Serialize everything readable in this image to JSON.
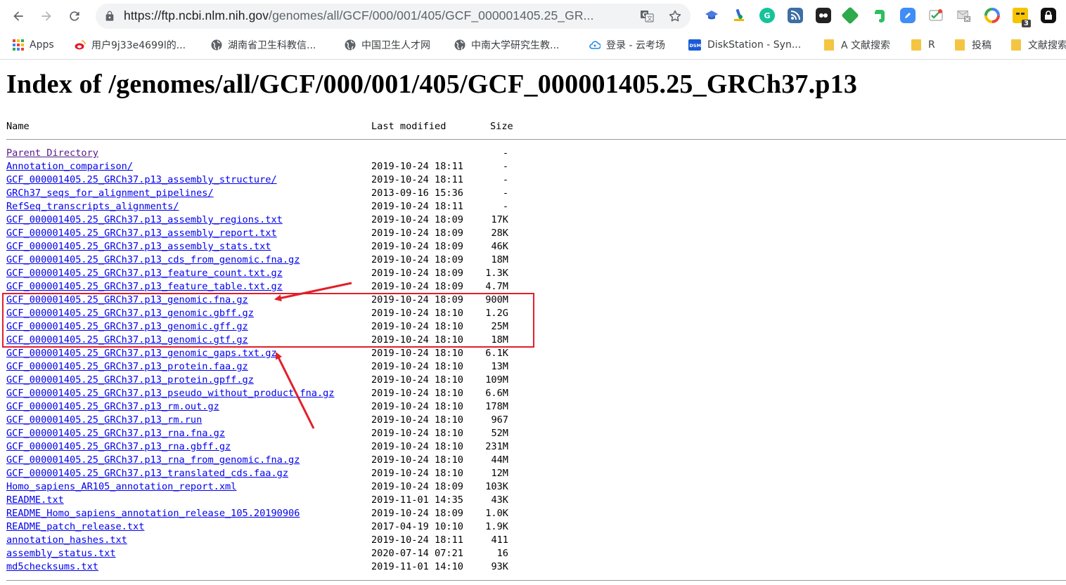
{
  "browser": {
    "url_host": "https://ftp.ncbi.nlm.nih.gov",
    "url_path": "/genomes/all/GCF/000/001/405/GCF_000001405.25_GR...",
    "extension_badge": "3"
  },
  "bookmarks": [
    {
      "label": "Apps",
      "icon": "apps-grid-icon"
    },
    {
      "label": "用户9j33e4699l的...",
      "icon": "weibo-icon"
    },
    {
      "label": "湖南省卫生科教信...",
      "icon": "globe-icon"
    },
    {
      "label": "中国卫生人才网",
      "icon": "globe-icon"
    },
    {
      "label": "中南大学研究生教...",
      "icon": "globe-icon"
    },
    {
      "label": "登录 - 云考场",
      "icon": "cloud-icon"
    },
    {
      "label": "DiskStation - Syn...",
      "icon": "dsm-icon"
    },
    {
      "label": "A 文献搜索",
      "icon": "folder-icon"
    },
    {
      "label": "R",
      "icon": "folder-icon"
    },
    {
      "label": "投稿",
      "icon": "folder-icon"
    },
    {
      "label": "文献搜索",
      "icon": "folder-icon"
    }
  ],
  "page": {
    "title": "Index of /genomes/all/GCF/000/001/405/GCF_000001405.25_GRCh37.p13",
    "columns": {
      "name": "Name",
      "modified": "Last modified",
      "size": "Size"
    },
    "rows": [
      {
        "name": "Parent Directory",
        "date": "",
        "size": "-"
      },
      {
        "name": "Annotation_comparison/",
        "date": "2019-10-24 18:11",
        "size": "-"
      },
      {
        "name": "GCF_000001405.25_GRCh37.p13_assembly_structure/",
        "date": "2019-10-24 18:11",
        "size": "-"
      },
      {
        "name": "GRCh37_seqs_for_alignment_pipelines/",
        "date": "2013-09-16 15:36",
        "size": "-"
      },
      {
        "name": "RefSeq_transcripts_alignments/",
        "date": "2019-10-24 18:11",
        "size": "-"
      },
      {
        "name": "GCF_000001405.25_GRCh37.p13_assembly_regions.txt",
        "date": "2019-10-24 18:09",
        "size": "17K"
      },
      {
        "name": "GCF_000001405.25_GRCh37.p13_assembly_report.txt",
        "date": "2019-10-24 18:09",
        "size": "28K"
      },
      {
        "name": "GCF_000001405.25_GRCh37.p13_assembly_stats.txt",
        "date": "2019-10-24 18:09",
        "size": "46K"
      },
      {
        "name": "GCF_000001405.25_GRCh37.p13_cds_from_genomic.fna.gz",
        "date": "2019-10-24 18:09",
        "size": "18M"
      },
      {
        "name": "GCF_000001405.25_GRCh37.p13_feature_count.txt.gz",
        "date": "2019-10-24 18:09",
        "size": "1.3K"
      },
      {
        "name": "GCF_000001405.25_GRCh37.p13_feature_table.txt.gz",
        "date": "2019-10-24 18:09",
        "size": "4.7M"
      },
      {
        "name": "GCF_000001405.25_GRCh37.p13_genomic.fna.gz",
        "date": "2019-10-24 18:09",
        "size": "900M"
      },
      {
        "name": "GCF_000001405.25_GRCh37.p13_genomic.gbff.gz",
        "date": "2019-10-24 18:10",
        "size": "1.2G"
      },
      {
        "name": "GCF_000001405.25_GRCh37.p13_genomic.gff.gz",
        "date": "2019-10-24 18:10",
        "size": "25M"
      },
      {
        "name": "GCF_000001405.25_GRCh37.p13_genomic.gtf.gz",
        "date": "2019-10-24 18:10",
        "size": "18M"
      },
      {
        "name": "GCF_000001405.25_GRCh37.p13_genomic_gaps.txt.gz",
        "date": "2019-10-24 18:10",
        "size": "6.1K"
      },
      {
        "name": "GCF_000001405.25_GRCh37.p13_protein.faa.gz",
        "date": "2019-10-24 18:10",
        "size": "13M"
      },
      {
        "name": "GCF_000001405.25_GRCh37.p13_protein.gpff.gz",
        "date": "2019-10-24 18:10",
        "size": "109M"
      },
      {
        "name": "GCF_000001405.25_GRCh37.p13_pseudo_without_product.fna.gz",
        "date": "2019-10-24 18:10",
        "size": "6.6M"
      },
      {
        "name": "GCF_000001405.25_GRCh37.p13_rm.out.gz",
        "date": "2019-10-24 18:10",
        "size": "178M"
      },
      {
        "name": "GCF_000001405.25_GRCh37.p13_rm.run",
        "date": "2019-10-24 18:10",
        "size": "967"
      },
      {
        "name": "GCF_000001405.25_GRCh37.p13_rna.fna.gz",
        "date": "2019-10-24 18:10",
        "size": "52M"
      },
      {
        "name": "GCF_000001405.25_GRCh37.p13_rna.gbff.gz",
        "date": "2019-10-24 18:10",
        "size": "231M"
      },
      {
        "name": "GCF_000001405.25_GRCh37.p13_rna_from_genomic.fna.gz",
        "date": "2019-10-24 18:10",
        "size": "44M"
      },
      {
        "name": "GCF_000001405.25_GRCh37.p13_translated_cds.faa.gz",
        "date": "2019-10-24 18:10",
        "size": "12M"
      },
      {
        "name": "Homo_sapiens_AR105_annotation_report.xml",
        "date": "2019-10-24 18:09",
        "size": "103K"
      },
      {
        "name": "README.txt",
        "date": "2019-11-01 14:35",
        "size": "43K"
      },
      {
        "name": "README_Homo_sapiens_annotation_release_105.20190906",
        "date": "2019-10-24 18:09",
        "size": "1.0K"
      },
      {
        "name": "README_patch_release.txt",
        "date": "2017-04-19 10:10",
        "size": "1.9K"
      },
      {
        "name": "annotation_hashes.txt",
        "date": "2019-10-24 18:11",
        "size": "411"
      },
      {
        "name": "assembly_status.txt",
        "date": "2020-07-14 07:21",
        "size": "16"
      },
      {
        "name": "md5checksums.txt",
        "date": "2019-11-01 14:10",
        "size": "93K"
      }
    ]
  },
  "colors": {
    "link": "#0000ee",
    "annotation_red": "#e0202a"
  }
}
